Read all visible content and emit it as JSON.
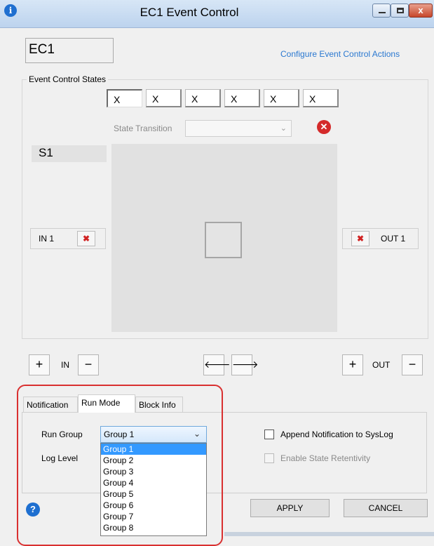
{
  "window": {
    "title": "EC1 Event Control"
  },
  "header": {
    "name": "EC1",
    "configure_link": "Configure Event Control Actions"
  },
  "states": {
    "group_label": "Event Control States",
    "buttons": [
      "X",
      "X",
      "X",
      "X",
      "X",
      "X"
    ],
    "transition_label": "State Transition",
    "transition_value": "",
    "current_state": "S1"
  },
  "ports": {
    "in_label": "IN 1",
    "out_label": "OUT 1",
    "in_group": "IN",
    "out_group": "OUT"
  },
  "controls": {
    "plus": "+",
    "minus": "−",
    "left_arrow": "🡐",
    "right_arrow": "🡒"
  },
  "tabs": [
    "Notification",
    "Run Mode",
    "Block Info"
  ],
  "active_tab": "Run Mode",
  "run_mode": {
    "run_group_label": "Run Group",
    "run_group_value": "Group 1",
    "log_level_label": "Log Level",
    "options": [
      "Group 1",
      "Group 2",
      "Group 3",
      "Group 4",
      "Group 5",
      "Group 6",
      "Group 7",
      "Group 8"
    ],
    "append_label": "Append Notification to SysLog",
    "retentivity_label": "Enable State Retentivity"
  },
  "footer": {
    "apply": "APPLY",
    "cancel": "CANCEL"
  },
  "colors": {
    "link": "#2a78d0",
    "highlight": "#3399ff",
    "annotation": "#d93030"
  },
  "icons": {
    "title": "info-icon",
    "help": "help-icon",
    "delete": "delete-icon",
    "remove": "remove-icon"
  }
}
